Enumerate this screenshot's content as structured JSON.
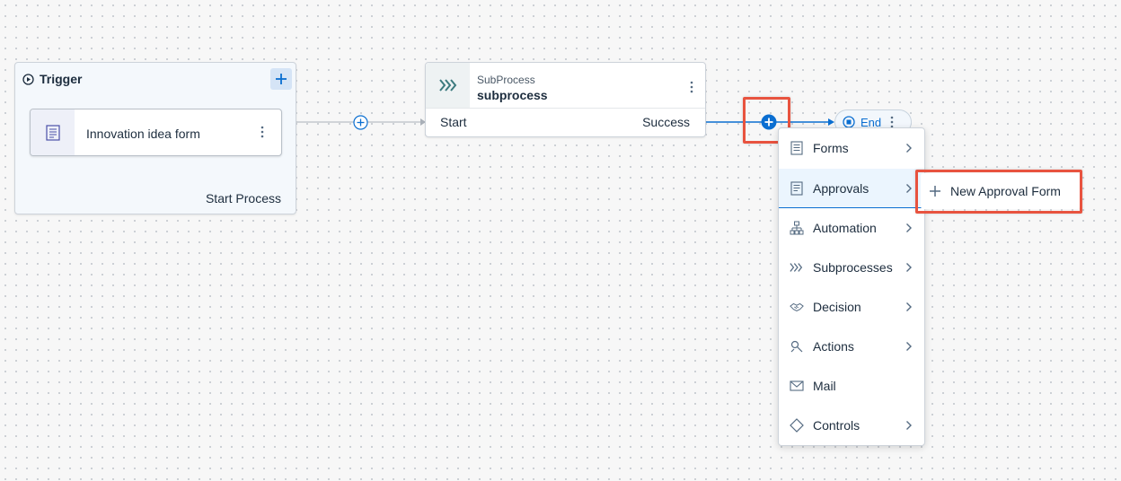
{
  "trigger": {
    "title": "Trigger",
    "form_tile": {
      "label": "Innovation idea form"
    },
    "footer": "Start Process"
  },
  "subprocess": {
    "type": "SubProcess",
    "name": "subprocess",
    "start": "Start",
    "success": "Success"
  },
  "end": {
    "label": "End"
  },
  "menu": {
    "items": [
      {
        "label": "Forms",
        "icon": "form-icon",
        "submenu": true
      },
      {
        "label": "Approvals",
        "icon": "approval-icon",
        "submenu": true,
        "selected": true
      },
      {
        "label": "Automation",
        "icon": "automation-icon",
        "submenu": true
      },
      {
        "label": "Subprocesses",
        "icon": "subprocess-icon",
        "submenu": true
      },
      {
        "label": "Decision",
        "icon": "decision-icon",
        "submenu": true
      },
      {
        "label": "Actions",
        "icon": "actions-icon",
        "submenu": true
      },
      {
        "label": "Mail",
        "icon": "mail-icon",
        "submenu": false
      },
      {
        "label": "Controls",
        "icon": "controls-icon",
        "submenu": true
      }
    ]
  },
  "submenu": {
    "new_approval_form": "New Approval Form"
  },
  "colors": {
    "accent": "#0a6ed1",
    "highlight": "#e8533f",
    "connector_gray": "#a9b0b8",
    "subprocess_icon": "#3c7a7e"
  }
}
